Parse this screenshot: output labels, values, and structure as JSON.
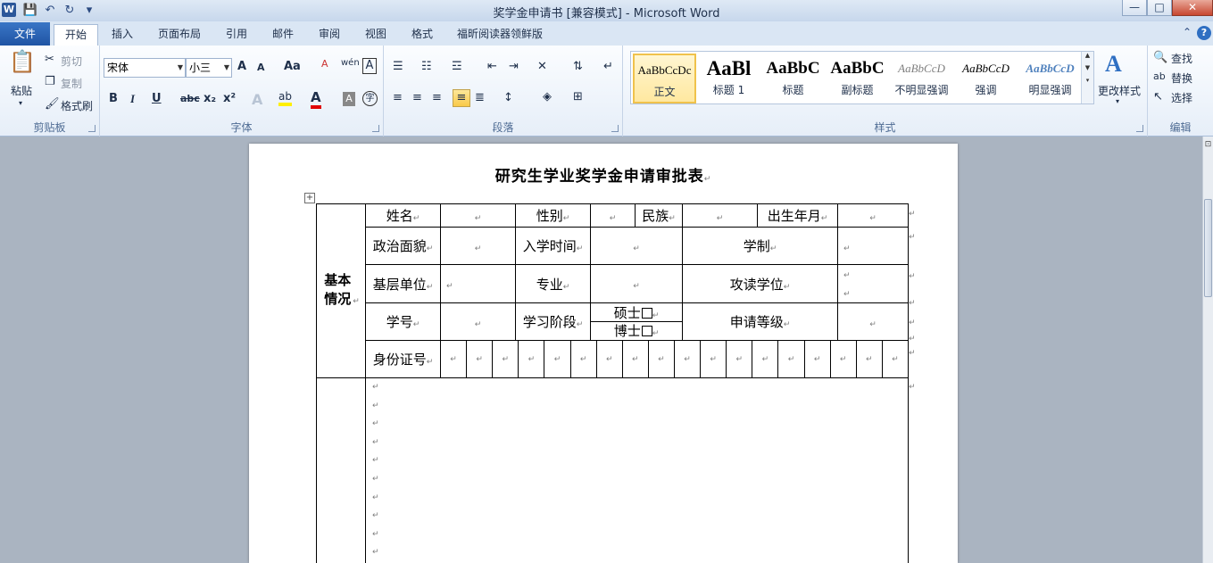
{
  "window": {
    "app_icon": "W",
    "title": "奖学金申请书 [兼容模式] - Microsoft Word",
    "minimize_icon": "—",
    "maximize_icon": "□",
    "close_icon": "✕"
  },
  "quick_access": {
    "save_icon": "💾",
    "undo_icon": "↶",
    "redo_icon": "↻",
    "customize_icon": "▾"
  },
  "tabs": [
    {
      "label": "文件"
    },
    {
      "label": "开始"
    },
    {
      "label": "插入"
    },
    {
      "label": "页面布局"
    },
    {
      "label": "引用"
    },
    {
      "label": "邮件"
    },
    {
      "label": "审阅"
    },
    {
      "label": "视图"
    },
    {
      "label": "格式"
    },
    {
      "label": "福昕阅读器领鲜版"
    }
  ],
  "tab_right": {
    "collapse_icon": "⌃",
    "help": "?"
  },
  "clipboard": {
    "label": "剪贴板",
    "paste": "粘贴",
    "cut": "剪切",
    "copy": "复制",
    "format_painter": "格式刷"
  },
  "font": {
    "label": "字体",
    "font_name": "宋体",
    "font_size": "小三",
    "grow": "A",
    "shrink": "A",
    "change_case": "Aa",
    "clear_format": "A",
    "phonetic": "wén",
    "border_char": "A",
    "bold": "B",
    "italic": "I",
    "underline": "U",
    "strike": "abc",
    "subscript": "x₂",
    "superscript": "x²",
    "effects": "A",
    "highlight": "ab",
    "font_color": "A",
    "shading": "A",
    "enclose": "字"
  },
  "paragraph": {
    "label": "段落"
  },
  "styles": {
    "label": "样式",
    "change_styles": "更改样式",
    "items": [
      {
        "sample": "AaBbCcDc",
        "name": "正文"
      },
      {
        "sample": "AaBl",
        "name": "标题 1"
      },
      {
        "sample": "AaBbC",
        "name": "标题"
      },
      {
        "sample": "AaBbC",
        "name": "副标题"
      },
      {
        "sample": "AaBbCcD",
        "name": "不明显强调"
      },
      {
        "sample": "AaBbCcD",
        "name": "强调"
      },
      {
        "sample": "AaBbCcD",
        "name": "明显强调"
      }
    ]
  },
  "editing": {
    "label": "编辑",
    "find": "查找",
    "replace": "替换",
    "select": "选择"
  },
  "document": {
    "title": "研究生学业奖学金申请审批表",
    "pilcrow": "↵",
    "move_handle": "+",
    "section_basic": "基本情况",
    "labels": {
      "name": "姓名",
      "gender": "性别",
      "ethnicity": "民族",
      "birth": "出生年月",
      "political": "政治面貌",
      "enroll": "入学时间",
      "schooling": "学制",
      "unit": "基层单位",
      "major": "专业",
      "degree": "攻读学位",
      "student_id": "学号",
      "stage": "学习阶段",
      "master": "硕士",
      "doctor": "博士",
      "grade": "申请等级",
      "id_card": "身份证号"
    },
    "id_digit_count": 18
  }
}
